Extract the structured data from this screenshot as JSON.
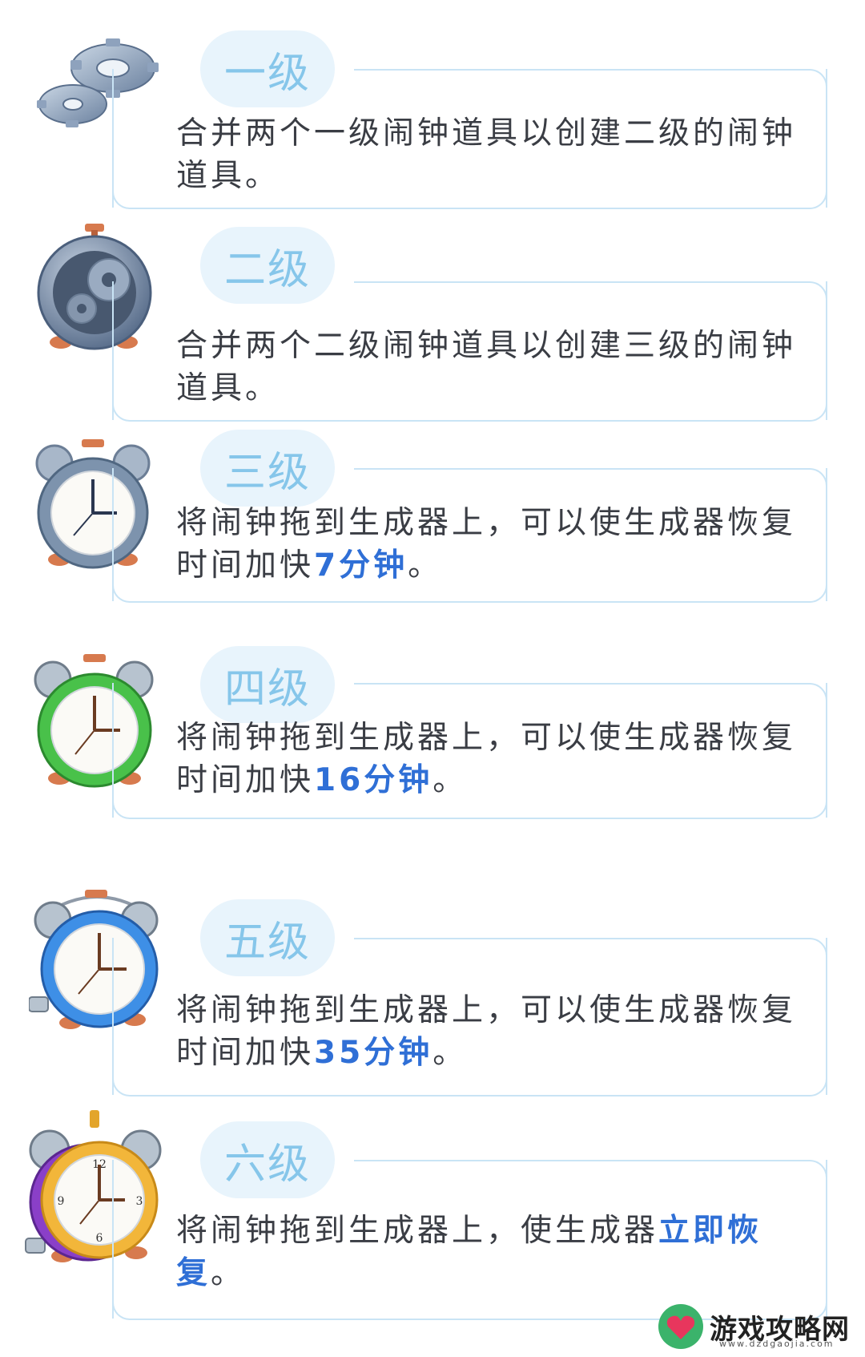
{
  "levels": [
    {
      "title": "一级",
      "text_a": "合并两个一级闹钟道具以创建二级的闹钟道具。",
      "hl": "",
      "text_b": "",
      "icon": "gears-icon"
    },
    {
      "title": "二级",
      "text_a": "合并两个二级闹钟道具以创建三级的闹钟道具。",
      "hl": "",
      "text_b": "",
      "icon": "gear-clock-icon"
    },
    {
      "title": "三级",
      "text_a": "将闹钟拖到生成器上，可以使生成器恢复时间加快",
      "hl": "7分钟",
      "text_b": "。",
      "icon": "gray-alarm-clock-icon"
    },
    {
      "title": "四级",
      "text_a": "将闹钟拖到生成器上，可以使生成器恢复时间加快",
      "hl": "16分钟",
      "text_b": "。",
      "icon": "green-alarm-clock-icon"
    },
    {
      "title": "五级",
      "text_a": "将闹钟拖到生成器上，可以使生成器恢复时间加快",
      "hl": "35分钟",
      "text_b": "。",
      "icon": "blue-alarm-clock-icon"
    },
    {
      "title": "六级",
      "text_a": "将闹钟拖到生成器上，使生成器",
      "hl": "立即恢复",
      "text_b": "。",
      "icon": "gold-alarm-clock-icon"
    }
  ],
  "watermark": {
    "name": "游戏攻略网",
    "url": "www.dzdgaojia.com"
  },
  "colors": {
    "accent": "#2f6fd6",
    "title": "#86c6ea",
    "border": "#c9e4f5",
    "pill_bg": "#e8f4fc"
  }
}
